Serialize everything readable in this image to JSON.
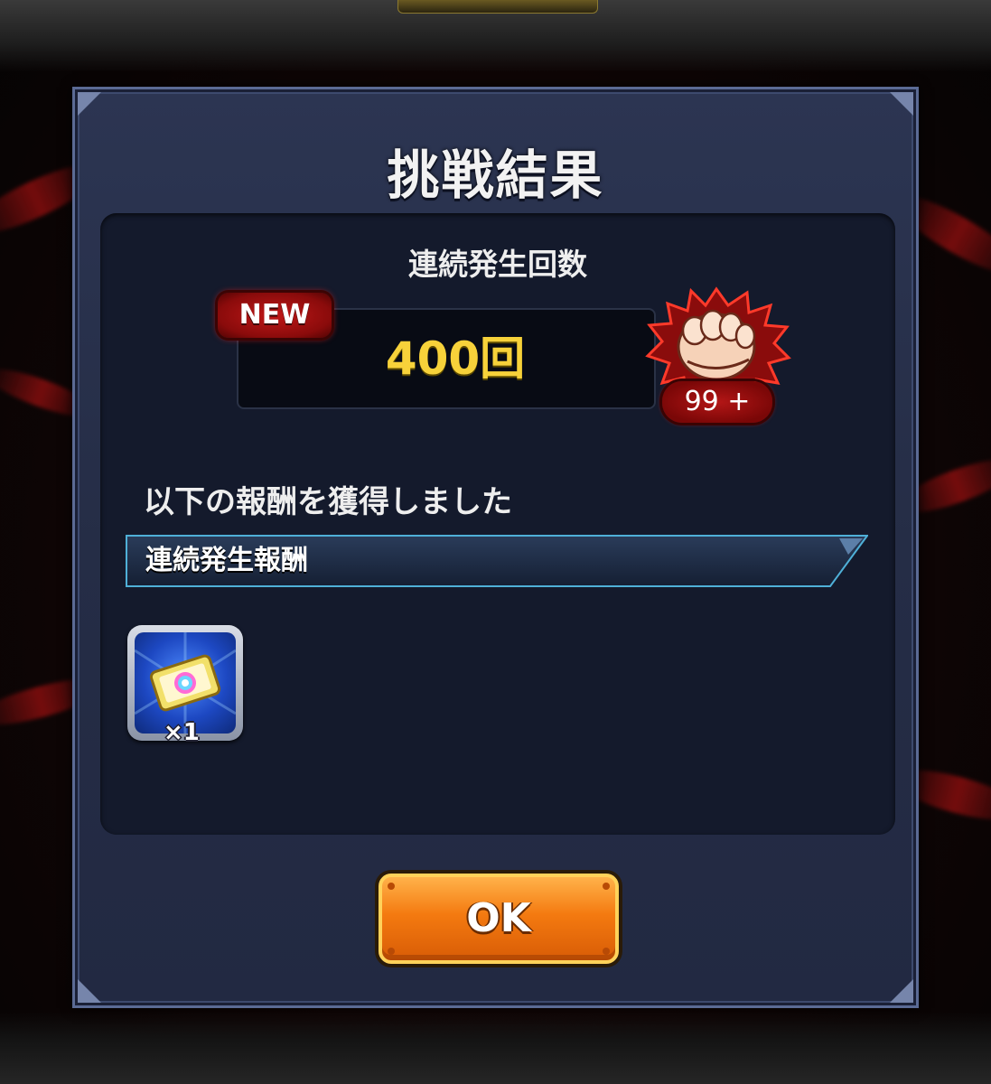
{
  "dialog": {
    "title": "挑戦結果",
    "count_label": "連続発生回数",
    "new_badge": "NEW",
    "count_value": "400回",
    "fist_count": "99 +",
    "reward_caption": "以下の報酬を獲得しました",
    "reward_header": "連続発生報酬",
    "rewards": [
      {
        "icon": "rainbow-ticket-icon",
        "quantity": "×1"
      }
    ],
    "ok_label": "OK"
  },
  "colors": {
    "count_value": "#f7d23a",
    "new_badge": "#c01818",
    "ok_button": "#f47a10",
    "panel": "#141a2c",
    "dialog": "#2c3552"
  }
}
